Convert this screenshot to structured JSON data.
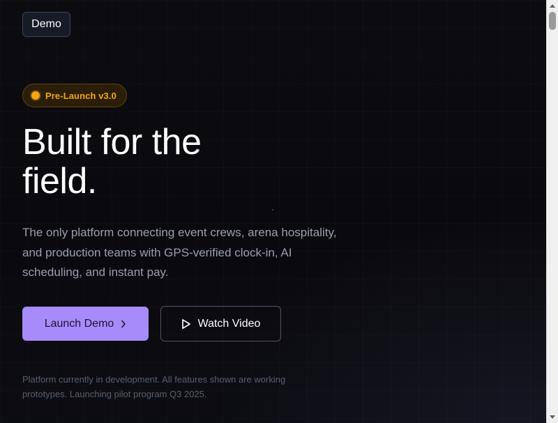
{
  "header": {
    "demo_label": "Demo"
  },
  "badge": {
    "label": "Pre-Launch v3.0",
    "color": "#f5a512"
  },
  "hero": {
    "headline_line1": "Built for the",
    "headline_line2": "field.",
    "subtext": "The only platform connecting event crews, arena hospitality, and production teams with GPS-verified clock-in, AI scheduling, and instant pay."
  },
  "actions": {
    "primary_label": "Launch Demo",
    "primary_icon": "chevron-right-icon",
    "primary_color": "#a78bfa",
    "secondary_label": "Watch Video",
    "secondary_icon": "play-icon"
  },
  "footnote": "Platform currently in development. All features shown are working prototypes. Launching pilot program Q3 2025.",
  "scrollbar": {
    "up_icon": "scroll-up-arrow",
    "down_icon": "scroll-down-arrow"
  }
}
